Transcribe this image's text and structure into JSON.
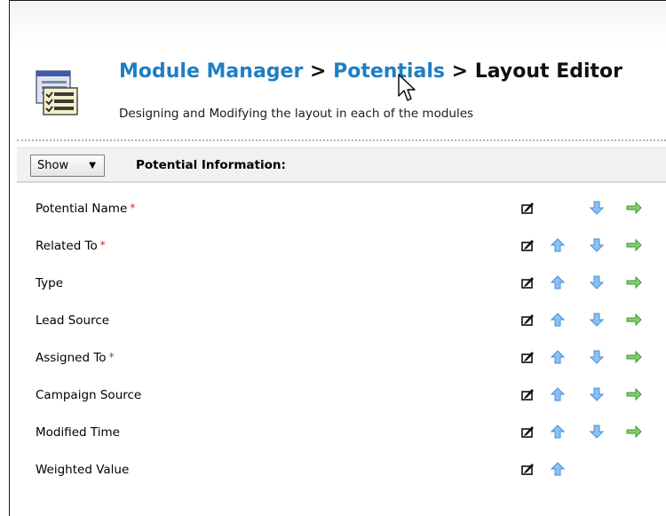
{
  "breadcrumb": {
    "module_manager": "Module Manager",
    "sep1": " > ",
    "module": "Potentials",
    "sep2": " > ",
    "current": "Layout Editor"
  },
  "subtitle": "Designing and Modifying the layout in each of the modules",
  "block": {
    "show_label": "Show",
    "caret": "▼",
    "title": "Potential Information:"
  },
  "required_marker": "*",
  "fields": [
    {
      "label": "Potential Name",
      "required": true,
      "up": false,
      "down": true,
      "move": true
    },
    {
      "label": "Related To",
      "required": true,
      "up": true,
      "down": true,
      "move": true
    },
    {
      "label": "Type",
      "required": false,
      "up": true,
      "down": true,
      "move": true
    },
    {
      "label": "Lead Source",
      "required": false,
      "up": true,
      "down": true,
      "move": true
    },
    {
      "label": "Assigned To",
      "required": true,
      "up": true,
      "down": true,
      "move": true
    },
    {
      "label": "Campaign Source",
      "required": false,
      "up": true,
      "down": true,
      "move": true
    },
    {
      "label": "Modified Time",
      "required": false,
      "up": true,
      "down": true,
      "move": true
    },
    {
      "label": "Weighted Value",
      "required": false,
      "up": true,
      "down": false,
      "move": false
    }
  ],
  "icons": {
    "edit": "edit-field-icon",
    "up": "move-up-arrow-icon",
    "down": "move-down-arrow-icon",
    "move": "move-to-block-arrow-icon"
  },
  "colors": {
    "link": "#1f7ec3",
    "required": "#e02020",
    "arrow_blue": "#5a9fe0",
    "arrow_green": "#4aa83a"
  }
}
